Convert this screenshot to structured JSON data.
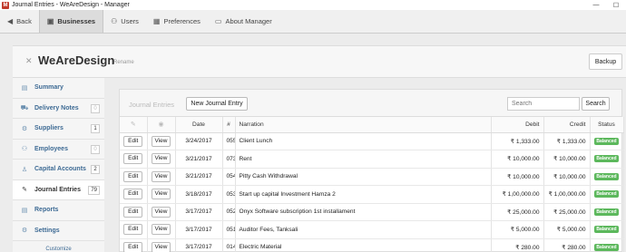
{
  "window": {
    "title": "Journal Entries - WeAreDesign - Manager",
    "logo_letter": "M"
  },
  "topnav": {
    "back": "Back",
    "businesses": "Businesses",
    "users": "Users",
    "preferences": "Preferences",
    "about": "About Manager"
  },
  "header": {
    "business_name": "WeAreDesign",
    "rename": "Rename",
    "backup": "Backup"
  },
  "sidebar": {
    "items": [
      {
        "label": "Summary",
        "count": ""
      },
      {
        "label": "Delivery Notes",
        "count": "0"
      },
      {
        "label": "Suppliers",
        "count": "1"
      },
      {
        "label": "Employees",
        "count": "0"
      },
      {
        "label": "Capital Accounts",
        "count": "2"
      },
      {
        "label": "Journal Entries",
        "count": "79"
      },
      {
        "label": "Reports",
        "count": ""
      },
      {
        "label": "Settings",
        "count": ""
      }
    ],
    "customize": "Customize"
  },
  "main": {
    "section_title": "Journal Entries",
    "new_entry": "New Journal Entry",
    "search_placeholder": "Search",
    "search_button": "Search",
    "columns": {
      "date": "Date",
      "number": "#",
      "narration": "Narration",
      "debit": "Debit",
      "credit": "Credit",
      "status": "Status"
    },
    "rows": [
      {
        "edit": "Edit",
        "view": "View",
        "date": "3/24/2017",
        "number": "055",
        "narration": "Client Lunch",
        "debit": "₹ 1,333.00",
        "credit": "₹ 1,333.00",
        "status": "Balanced"
      },
      {
        "edit": "Edit",
        "view": "View",
        "date": "3/21/2017",
        "number": "073",
        "narration": "Rent",
        "debit": "₹ 10,000.00",
        "credit": "₹ 10,000.00",
        "status": "Balanced"
      },
      {
        "edit": "Edit",
        "view": "View",
        "date": "3/21/2017",
        "number": "054",
        "narration": "Pitty Cash Withdrawal",
        "debit": "₹ 10,000.00",
        "credit": "₹ 10,000.00",
        "status": "Balanced"
      },
      {
        "edit": "Edit",
        "view": "View",
        "date": "3/18/2017",
        "number": "053",
        "narration": "Start up capital Investment Hamza 2",
        "debit": "₹ 1,00,000.00",
        "credit": "₹ 1,00,000.00",
        "status": "Balanced"
      },
      {
        "edit": "Edit",
        "view": "View",
        "date": "3/17/2017",
        "number": "052",
        "narration": "Onyx Software subscription 1st installament",
        "debit": "₹ 25,000.00",
        "credit": "₹ 25,000.00",
        "status": "Balanced"
      },
      {
        "edit": "Edit",
        "view": "View",
        "date": "3/17/2017",
        "number": "051",
        "narration": "Auditor Fees, Tanksali",
        "debit": "₹ 5,000.00",
        "credit": "₹ 5,000.00",
        "status": "Balanced"
      },
      {
        "edit": "Edit",
        "view": "View",
        "date": "3/17/2017",
        "number": "014",
        "narration": "Electric Material",
        "debit": "₹ 280.00",
        "credit": "₹ 280.00",
        "status": "Balanced"
      }
    ]
  },
  "colors": {
    "accent_link": "#3d6a94",
    "balanced_badge": "#5cb85c",
    "logo": "#c0392b"
  }
}
